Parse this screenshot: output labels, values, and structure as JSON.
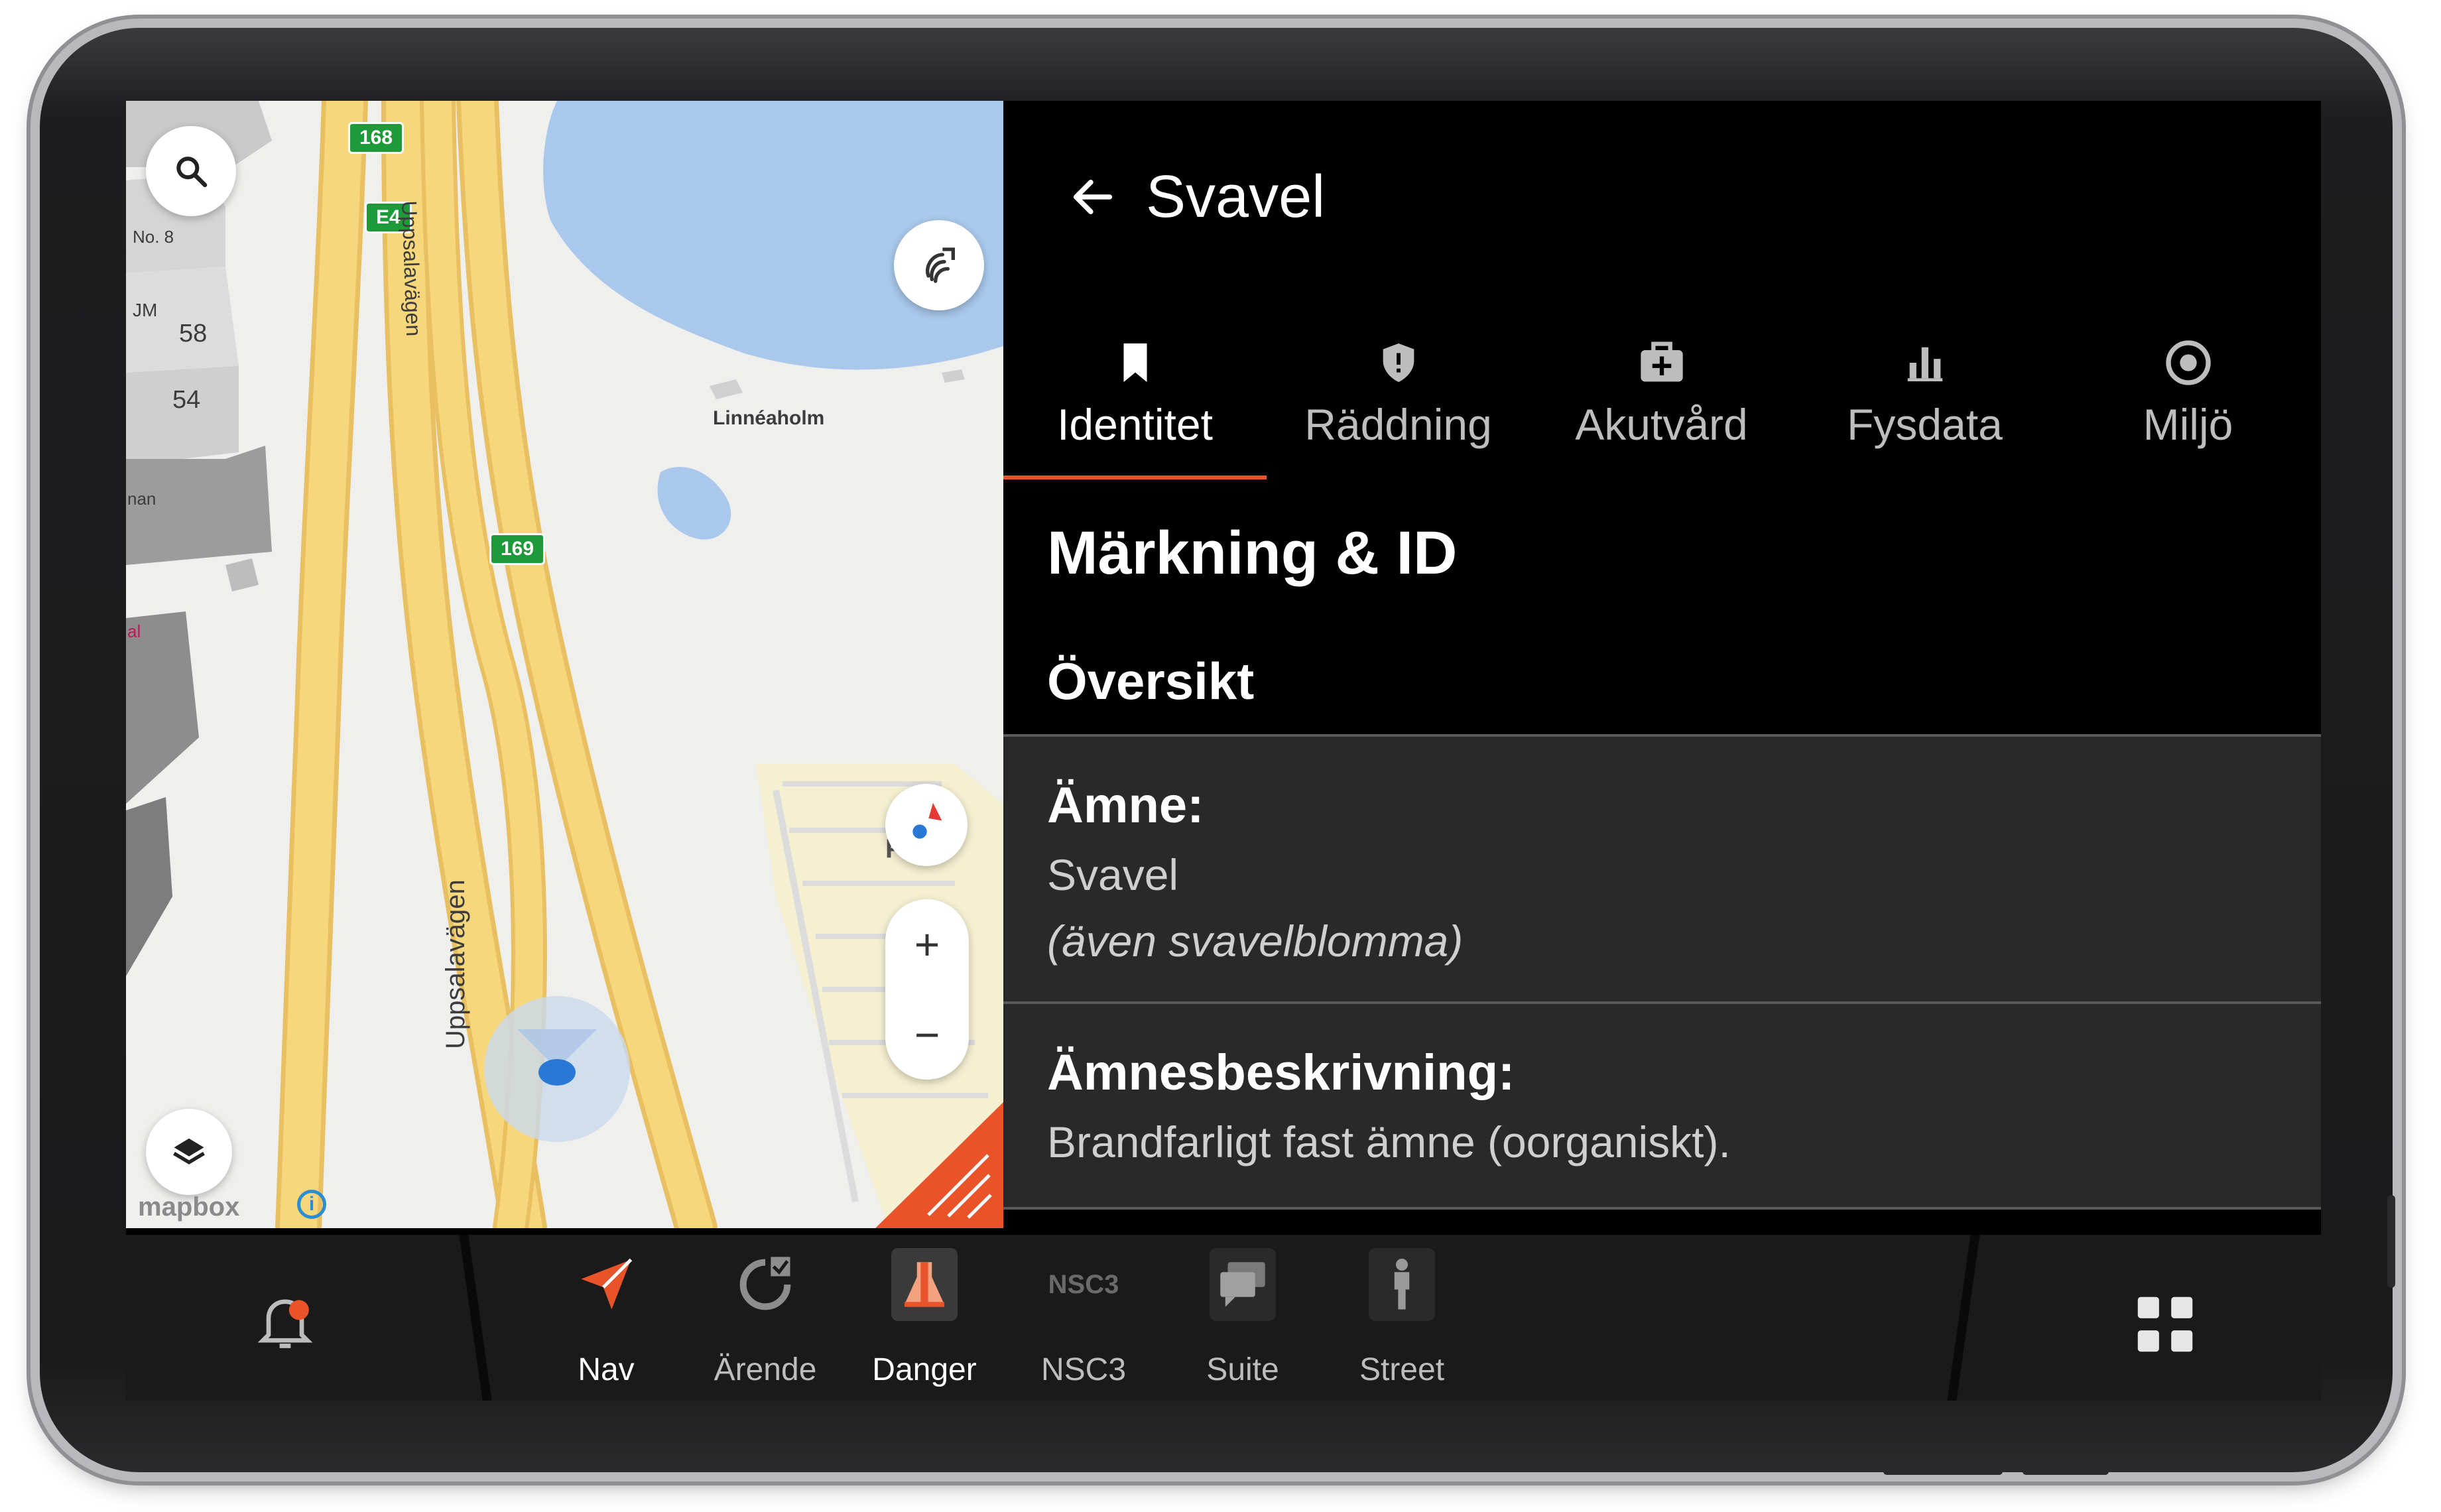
{
  "map": {
    "shields": [
      "168",
      "E4",
      "169"
    ],
    "labels": {
      "road_top": "Uppsalavägen",
      "road_bottom": "Uppsalavägen",
      "place": "Linnéaholm",
      "no8": "No. 8",
      "jm": "JM",
      "b58": "58",
      "b54": "54",
      "nan": "nan",
      "al": "al",
      "parking": "P"
    },
    "zoom_in": "+",
    "zoom_out": "−",
    "attribution": "mapbox",
    "info": "i"
  },
  "header": {
    "title": "Svavel"
  },
  "tabs": [
    {
      "label": "Identitet",
      "icon": "bookmark-icon"
    },
    {
      "label": "Räddning",
      "icon": "shield-icon"
    },
    {
      "label": "Akutvård",
      "icon": "medkit-icon"
    },
    {
      "label": "Fysdata",
      "icon": "bar-chart-icon"
    },
    {
      "label": "Miljö",
      "icon": "target-icon"
    }
  ],
  "content": {
    "section_title": "Märkning & ID",
    "subsection_title": "Översikt",
    "cards": [
      {
        "label": "Ämne:",
        "value": "Svavel",
        "value2": "(även svavelblomma)"
      },
      {
        "label": "Ämnesbeskrivning:",
        "value": "Brandfarligt fast ämne (oorganiskt)."
      }
    ]
  },
  "bottombar": {
    "apps": [
      {
        "label": "Nav",
        "icon": "navigation-arrow-icon"
      },
      {
        "label": "Ärende",
        "icon": "refresh-check-icon"
      },
      {
        "label": "Danger",
        "icon": "flask-icon"
      },
      {
        "label": "NSC3",
        "icon": "nsc3-logo-icon",
        "icon_text": "NSC3"
      },
      {
        "label": "Suite",
        "icon": "chat-bubbles-icon"
      },
      {
        "label": "Street",
        "icon": "person-icon"
      }
    ]
  },
  "colors": {
    "accent": "#e8532a",
    "panel_bg": "#000000",
    "card_bg": "#292929",
    "road": "#f7d77b",
    "water": "#a9c8eb",
    "shield": "#1f9a3b"
  }
}
